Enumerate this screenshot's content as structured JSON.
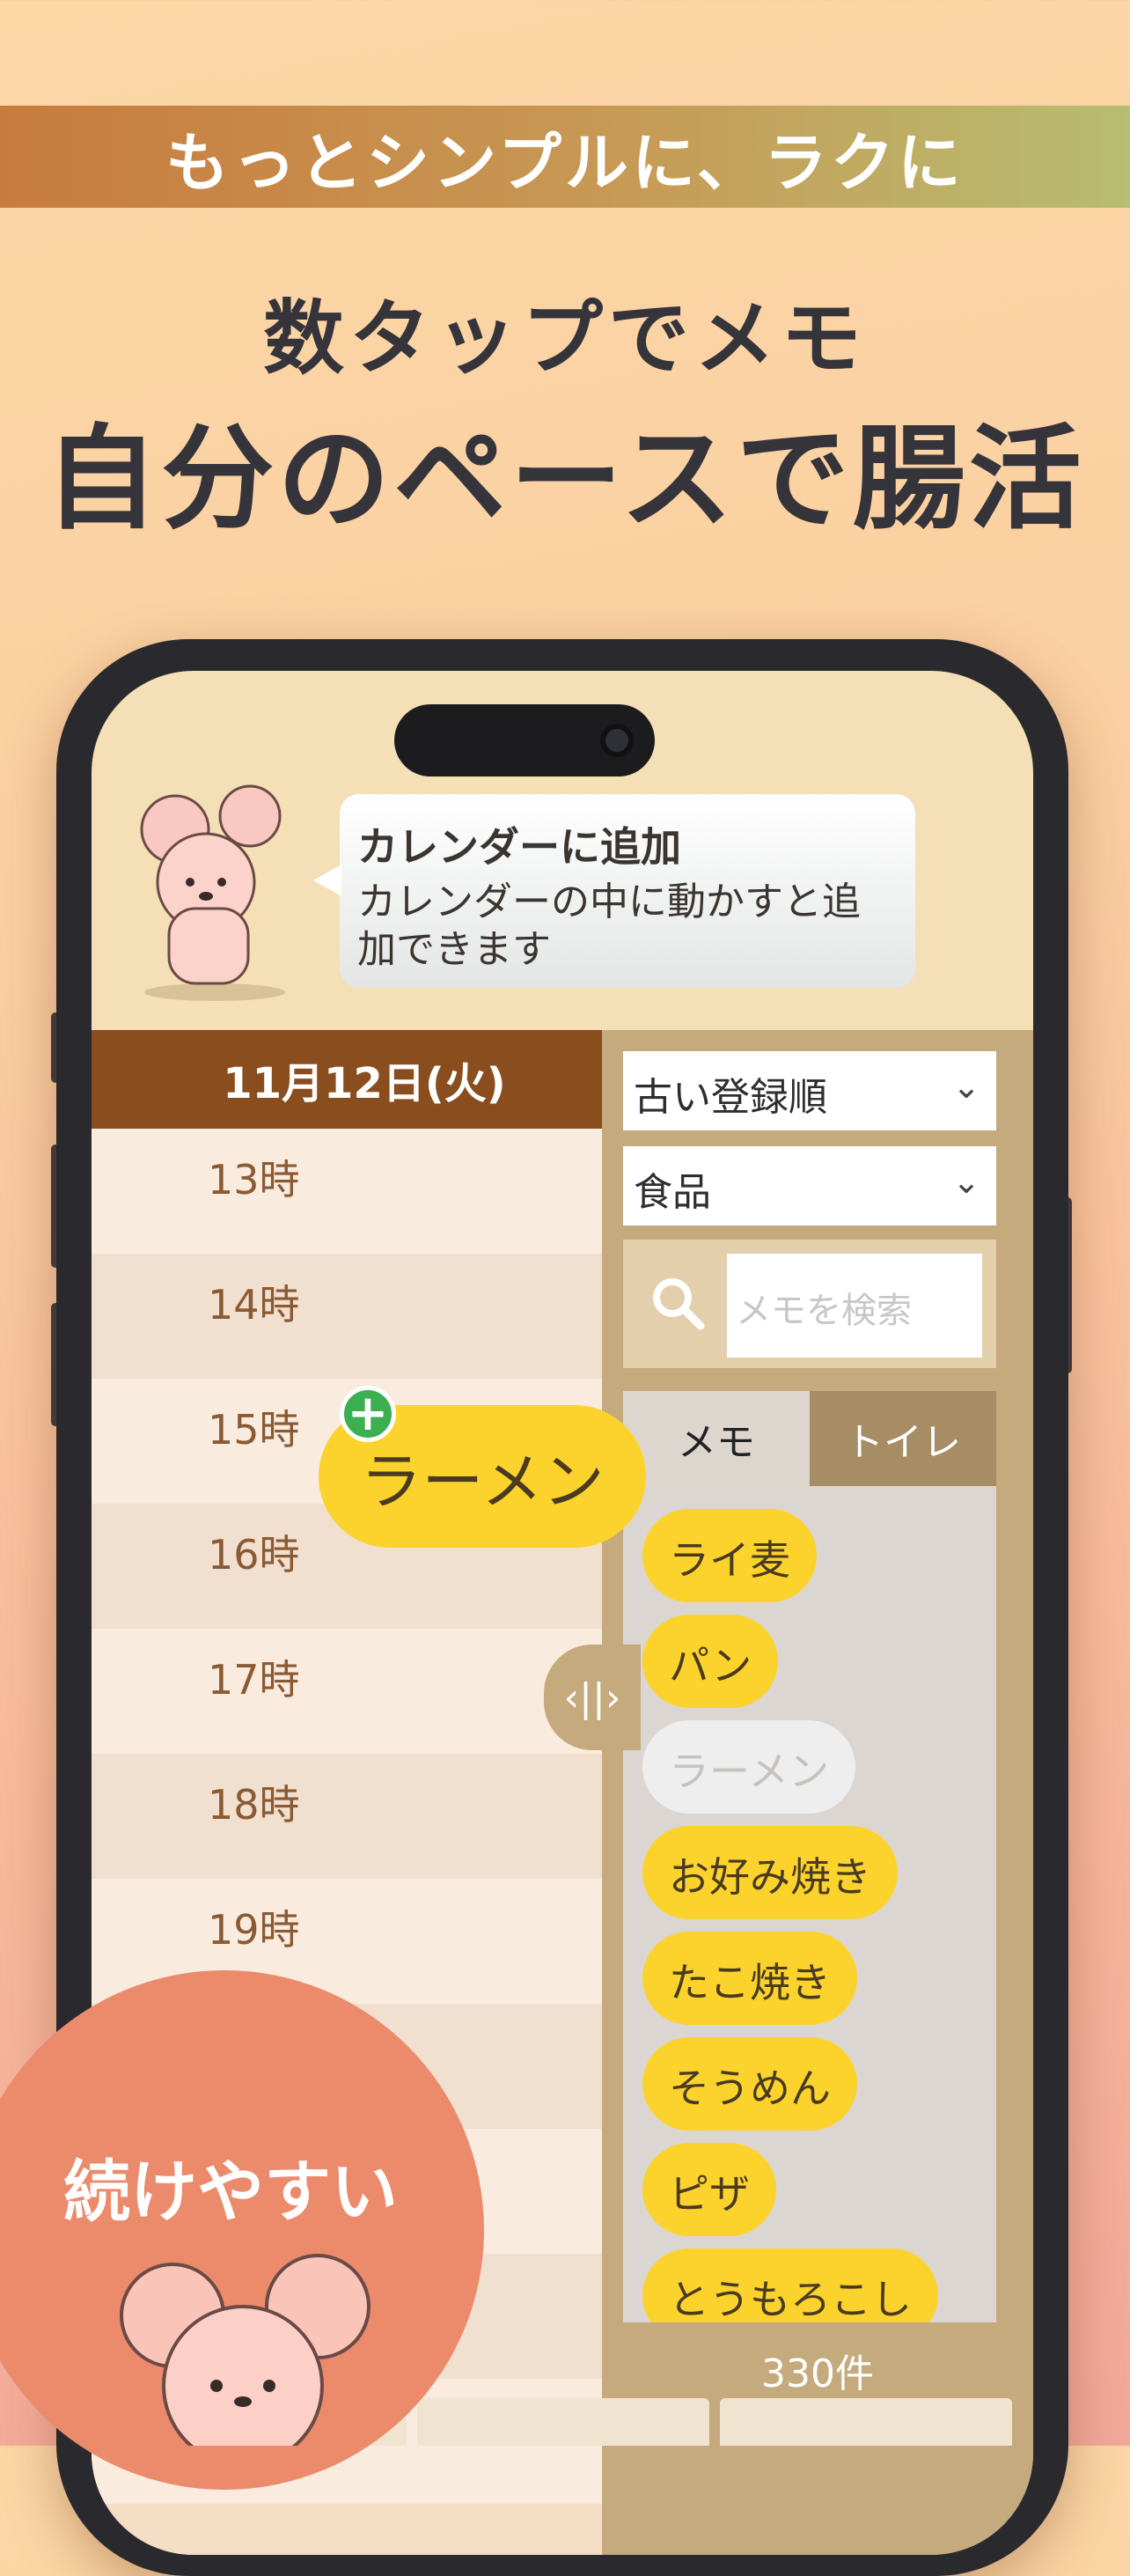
{
  "banner": "もっとシンプルに、ラクに",
  "headline1": "数タップでメモ",
  "headline2": "自分のペースで腸活",
  "bubble": {
    "title": "カレンダーに追加",
    "body": "カレンダーの中に動かすと追加できます"
  },
  "calendar": {
    "date": "11月12日(火)",
    "hours": [
      "13時",
      "14時",
      "15時",
      "16時",
      "17時",
      "18時",
      "19時"
    ]
  },
  "sort_select": "古い登録順",
  "category_select": "食品",
  "search": {
    "placeholder": "メモを検索"
  },
  "tabs": [
    {
      "label": "メモ",
      "active": true
    },
    {
      "label": "トイレ",
      "active": false
    }
  ],
  "chips": [
    "ライ麦",
    "パン",
    "ラーメン",
    "お好み焼き",
    "たこ焼き",
    "そうめん",
    "ピザ",
    "とうもろこし"
  ],
  "dragging_chip": "ラーメン",
  "count": "330件",
  "badge": "続けやすい",
  "colors": {
    "chip": "#fbd32c",
    "cal_header": "#8a4d1d",
    "panel": "#c4aa7c",
    "badge": "#ec8a6c"
  }
}
